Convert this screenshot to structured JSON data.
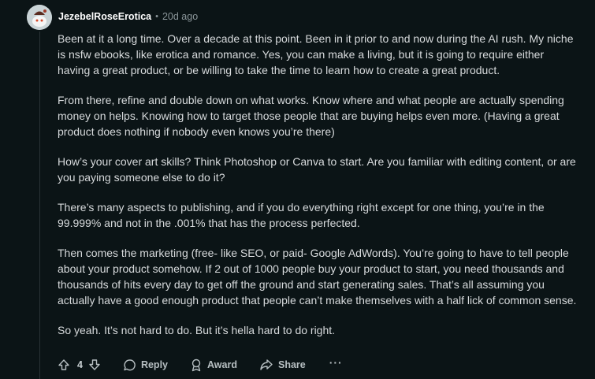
{
  "comment": {
    "author": "JezebelRoseErotica",
    "separator": "•",
    "age": "20d ago",
    "paragraphs": [
      "Been at it a long time. Over a decade at this point. Been in it prior to and now during the AI rush. My niche is nsfw ebooks, like erotica and romance. Yes, you can make a living, but it is going to require either having a great product, or be willing to take the time to learn how to create a great product.",
      "From there, refine and double down on what works. Know where and what people are actually spending money on helps. Knowing how to target those people that are buying helps even more. (Having a great product does nothing if nobody even knows you’re there)",
      "How’s your cover art skills? Think Photoshop or Canva to start. Are you familiar with editing content, or are you paying someone else to do it?",
      "There’s many aspects to publishing, and if you do everything right except for one thing, you’re in the 99.999% and not in the .001% that has the process perfected.",
      "Then comes the marketing (free- like SEO, or paid- Google AdWords). You’re going to have to tell people about your product somehow. If 2 out of 1000 people buy your product to start, you need thousands and thousands of hits every day to get off the ground and start generating sales. That’s all assuming you actually have a good enough product that people can’t make themselves with a half lick of common sense.",
      "So yeah. It’s not hard to do. But it’s hella hard to do right."
    ]
  },
  "actions": {
    "score": "4",
    "reply_label": "Reply",
    "award_label": "Award",
    "share_label": "Share",
    "more_label": "···"
  },
  "icons": {
    "upvote": "upvote-arrow-icon",
    "downvote": "downvote-arrow-icon",
    "reply": "speech-bubble-icon",
    "award": "award-ribbon-icon",
    "share": "share-arrow-icon",
    "avatar": "snoo-avatar"
  },
  "colors": {
    "background": "#0b1416",
    "text": "#d7dadc",
    "muted": "#8a9599",
    "username": "#ffffff"
  }
}
